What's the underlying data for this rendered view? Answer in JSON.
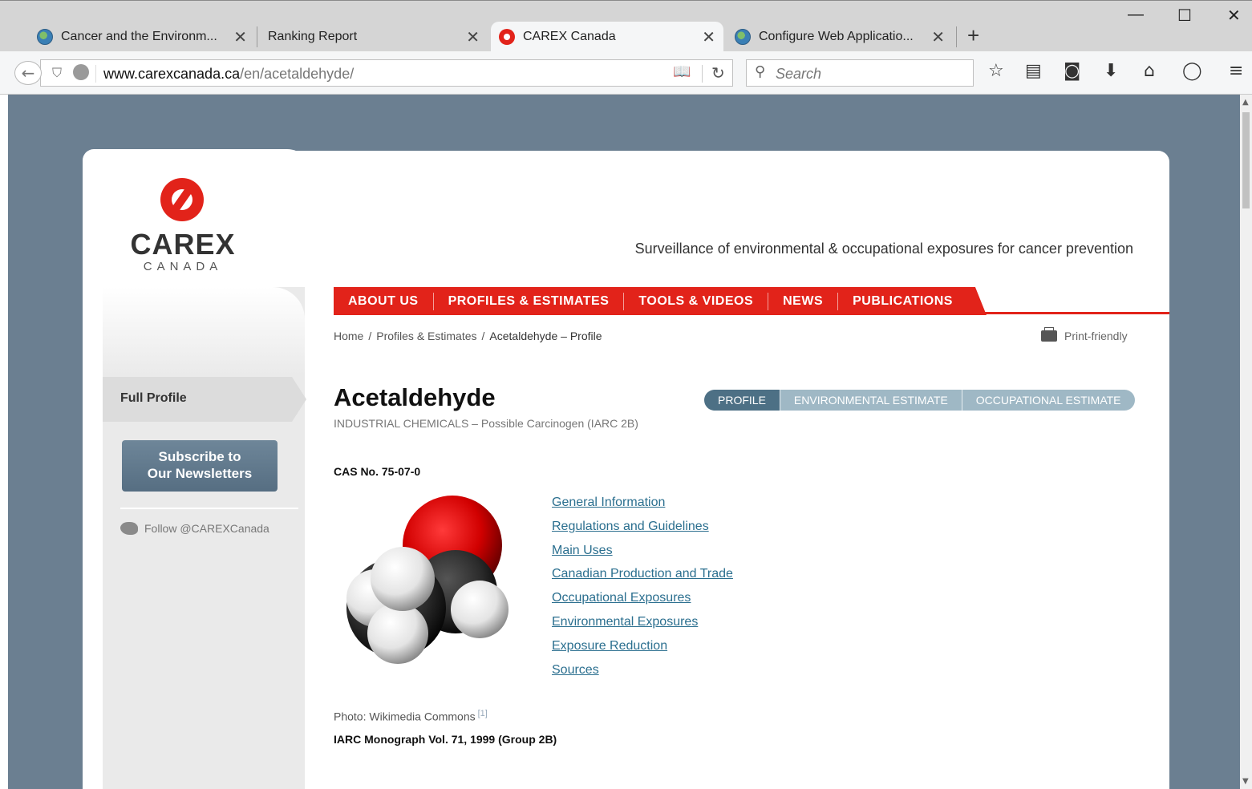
{
  "browser": {
    "tabs": [
      {
        "title": "Cancer and the Environm..."
      },
      {
        "title": "Ranking Report"
      },
      {
        "title": "CAREX Canada"
      },
      {
        "title": "Configure Web Applicatio..."
      }
    ],
    "url_domain": "www.carexcanada.ca",
    "url_path": "/en/acetaldehyde/",
    "search_placeholder": "Search"
  },
  "site": {
    "logo_word": "CAREX",
    "logo_sub": "CANADA",
    "tagline": "Surveillance of environmental & occupational exposures for cancer prevention",
    "nav": [
      "ABOUT US",
      "PROFILES & ESTIMATES",
      "TOOLS & VIDEOS",
      "NEWS",
      "PUBLICATIONS"
    ],
    "breadcrumb": [
      "Home",
      "Profiles & Estimates",
      "Acetaldehyde – Profile"
    ],
    "print_label": "Print-friendly"
  },
  "sidebar": {
    "full_profile": "Full Profile",
    "subscribe_line1": "Subscribe to",
    "subscribe_line2": "Our Newsletters",
    "follow": "Follow @CAREXCanada"
  },
  "profile": {
    "title": "Acetaldehyde",
    "subtitle": "INDUSTRIAL CHEMICALS – Possible Carcinogen (IARC 2B)",
    "tabs": [
      "PROFILE",
      "ENVIRONMENTAL ESTIMATE",
      "OCCUPATIONAL ESTIMATE"
    ],
    "cas": "CAS No. 75-07-0",
    "links": [
      "General Information",
      "Regulations and Guidelines",
      "Main Uses",
      "Canadian Production and Trade",
      "Occupational Exposures",
      "Environmental Exposures",
      "Exposure Reduction",
      "Sources"
    ],
    "photo_credit": "Photo: Wikimedia Commons",
    "photo_ref": "[1]",
    "iarc": "IARC Monograph Vol. 71, 1999 (Group 2B)"
  },
  "colors": {
    "brand_red": "#e2231a",
    "page_bg": "#6b7f91",
    "tab_active": "#4d7085",
    "tab_inactive": "#9fb8c5",
    "link": "#2b6f8f"
  }
}
